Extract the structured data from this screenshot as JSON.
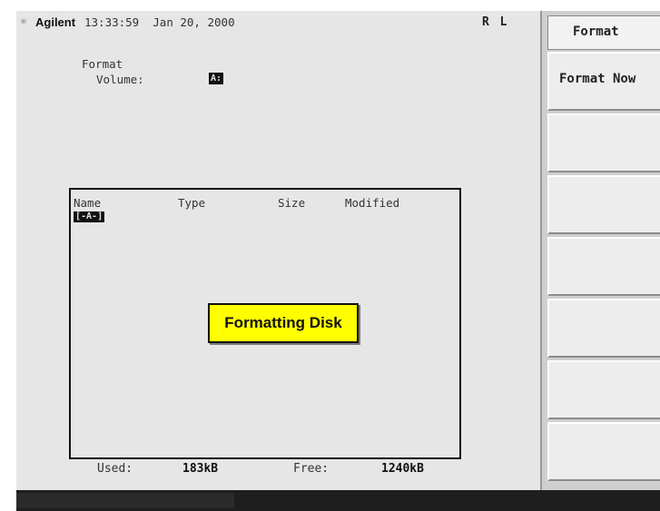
{
  "header": {
    "logo_icon": "sparkle-icon",
    "brand": "Agilent",
    "time": "13:33:59",
    "date": "Jan 20, 2000",
    "status": "R L"
  },
  "main": {
    "format_label": "Format",
    "volume_label": "Volume:",
    "volume_value": "A:"
  },
  "file_list": {
    "columns": [
      "Name",
      "Type",
      "Size",
      "Modified"
    ],
    "entries": [
      "[-A-]"
    ]
  },
  "dialog": {
    "message": "Formatting Disk"
  },
  "footer": {
    "used_label": "Used:",
    "used_value": "183kB",
    "free_label": "Free:",
    "free_value": "1240kB"
  },
  "softkeys": {
    "title": "Format",
    "keys": [
      "Format Now",
      "",
      "",
      "",
      "",
      "",
      ""
    ]
  },
  "colors": {
    "dialog_bg": "#ffff00",
    "screen_bg": "#e6e6e6"
  }
}
